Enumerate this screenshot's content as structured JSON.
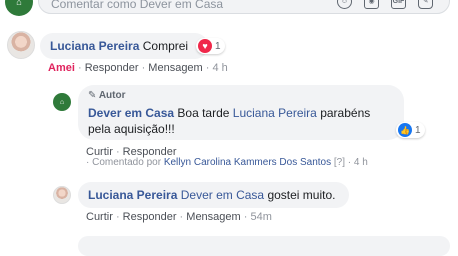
{
  "composer": {
    "placeholder": "Comentar como Dever em Casa",
    "icons": [
      "emoji-icon",
      "camera-icon",
      "gif-icon",
      "sticker-icon"
    ],
    "gif_label": "GIF"
  },
  "comments": [
    {
      "author": "Luciana Pereira",
      "text": "Comprei",
      "reaction": {
        "type": "heart",
        "count": "1"
      },
      "actions": {
        "liked": "Amei",
        "reply": "Responder",
        "message": "Mensagem",
        "time": "4 h"
      },
      "replies": [
        {
          "author_badge": "Autor",
          "author": "Dever em Casa",
          "text_before": "Boa tarde",
          "mention": "Luciana Pereira",
          "text_after": "parabéns pela aquisição!!!",
          "reaction": {
            "type": "like",
            "count": "1"
          },
          "actions": {
            "like": "Curtir",
            "reply": "Responder"
          },
          "commented_by": {
            "label": "Comentado por",
            "name": "Kellyn Carolina Kammers Dos Santos",
            "marker": "[?]",
            "time": "4 h"
          }
        },
        {
          "author": "Luciana Pereira",
          "mention": "Dever em Casa",
          "text_after": "gostei muito.",
          "actions": {
            "like": "Curtir",
            "reply": "Responder",
            "message": "Mensagem",
            "time": "54m"
          }
        }
      ]
    }
  ],
  "colors": {
    "link": "#385898",
    "bubble": "#f2f3f5",
    "heart": "#f0284a",
    "like": "#1877f2",
    "amei": "#e0245e"
  }
}
